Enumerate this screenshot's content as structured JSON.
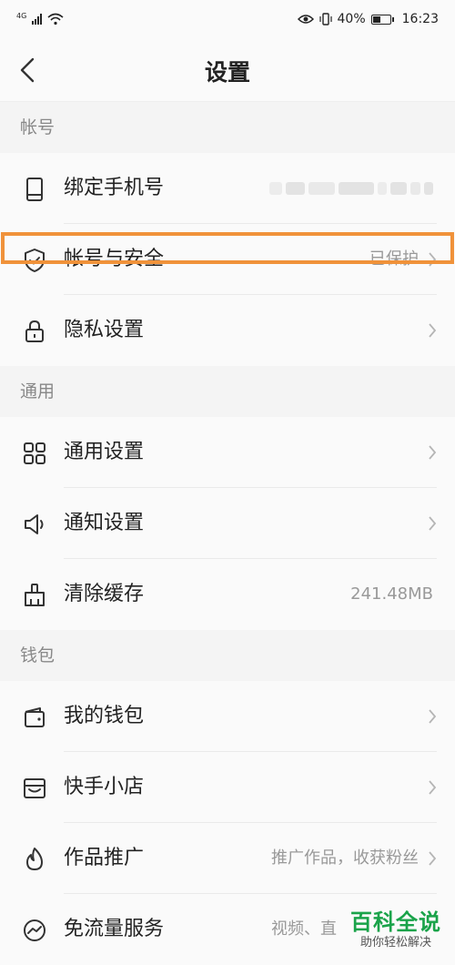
{
  "status_bar": {
    "network": "4G",
    "battery_percent_text": "40%",
    "battery_level": 0.4,
    "time": "16:23"
  },
  "header": {
    "title": "设置"
  },
  "sections": {
    "account": "帐号",
    "general": "通用",
    "wallet": "钱包"
  },
  "rows": {
    "bind_phone": {
      "label": "绑定手机号",
      "icon": "phone-icon"
    },
    "account_security": {
      "label": "帐号与安全",
      "value": "已保护",
      "icon": "shield-icon"
    },
    "privacy": {
      "label": "隐私设置",
      "icon": "lock-icon"
    },
    "general_settings": {
      "label": "通用设置",
      "icon": "grid-icon"
    },
    "notification": {
      "label": "通知设置",
      "icon": "speaker-icon"
    },
    "clear_cache": {
      "label": "清除缓存",
      "value": "241.48MB",
      "icon": "broom-icon"
    },
    "my_wallet": {
      "label": "我的钱包",
      "icon": "wallet-icon"
    },
    "shop": {
      "label": "快手小店",
      "icon": "store-icon"
    },
    "promotion": {
      "label": "作品推广",
      "value": "推广作品，收获粉丝",
      "icon": "flame-icon"
    },
    "free_data": {
      "label": "免流量服务",
      "value": "视频、直",
      "icon": "trend-icon"
    }
  },
  "watermark": {
    "main": "百科全说",
    "sub": "助你轻松解决"
  },
  "colors": {
    "highlight": "#f0923a",
    "watermark": "#1aa34a"
  }
}
